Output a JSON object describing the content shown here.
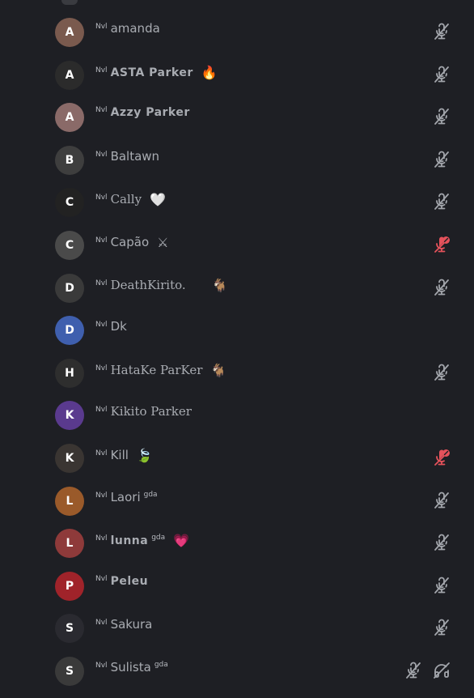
{
  "members": [
    {
      "lvl": "Nvl",
      "name": "amanda",
      "style": "normal",
      "avatar_color": "#7a5a4e",
      "initial": "A",
      "emoji": "",
      "status": [
        "mic-muted"
      ]
    },
    {
      "lvl": "Nvl",
      "name": "ASTA Parker",
      "style": "bold",
      "avatar_color": "#2b2b2b",
      "initial": "A",
      "emoji": "🔥",
      "status": [
        "mic-muted"
      ]
    },
    {
      "lvl": "Nvl",
      "name": "Azzy Parker",
      "style": "bold",
      "avatar_color": "#8a6a68",
      "initial": "A",
      "emoji": "",
      "status": [
        "mic-muted"
      ]
    },
    {
      "lvl": "Nvl",
      "name": "Baltawn",
      "style": "normal",
      "avatar_color": "#3e3e3e",
      "initial": "B",
      "emoji": "",
      "status": [
        "mic-muted"
      ]
    },
    {
      "lvl": "Nvl",
      "name": "Cally",
      "style": "serif",
      "avatar_color": "#222222",
      "initial": "C",
      "emoji": "🤍",
      "status": [
        "mic-muted"
      ]
    },
    {
      "lvl": "Nvl",
      "name": "Capão",
      "style": "normal",
      "avatar_color": "#4a4a4a",
      "initial": "C",
      "emoji": "⚔",
      "status": [
        "server-muted"
      ]
    },
    {
      "lvl": "Nvl",
      "name": "DeathKirito.",
      "style": "serif",
      "avatar_color": "#3a3a3a",
      "initial": "D",
      "emoji": "🐐",
      "emoji_far": true,
      "status": [
        "mic-muted"
      ]
    },
    {
      "lvl": "Nvl",
      "name": "Dk",
      "style": "normal",
      "avatar_color": "#3f5fae",
      "initial": "D",
      "emoji": "",
      "status": []
    },
    {
      "lvl": "Nvl",
      "name": "HataKe ParKer",
      "style": "serif",
      "avatar_color": "#2e2e2e",
      "initial": "H",
      "emoji": "🐐",
      "status": [
        "mic-muted"
      ]
    },
    {
      "lvl": "Nvl",
      "name": "Kikito Parker",
      "style": "serif",
      "avatar_color": "#5a3a8e",
      "initial": "K",
      "emoji": "",
      "status": []
    },
    {
      "lvl": "Nvl",
      "name": "Kill",
      "style": "normal",
      "avatar_color": "#3a3532",
      "initial": "K",
      "emoji": "🍃",
      "status": [
        "server-muted"
      ]
    },
    {
      "lvl": "Nvl",
      "name": "Laori",
      "style": "normal",
      "avatar_color": "#9a5a2a",
      "initial": "L",
      "tag": "gda",
      "emoji": "",
      "status": [
        "mic-muted"
      ]
    },
    {
      "lvl": "Nvl",
      "name": "lunna",
      "style": "bold",
      "avatar_color": "#8e3a3a",
      "initial": "L",
      "tag": "gda",
      "emoji": "💗",
      "status": [
        "mic-muted"
      ]
    },
    {
      "lvl": "Nvl",
      "name": "Peleu",
      "style": "bold",
      "avatar_color": "#a0232a",
      "initial": "P",
      "emoji": "",
      "status": [
        "mic-muted"
      ]
    },
    {
      "lvl": "Nvl",
      "name": "Sakura",
      "style": "normal",
      "avatar_color": "#2a2a30",
      "initial": "S",
      "emoji": "",
      "status": [
        "mic-muted"
      ]
    },
    {
      "lvl": "Nvl",
      "name": "Sulista",
      "style": "normal",
      "avatar_color": "#3a3a3a",
      "initial": "S",
      "tag": "gda",
      "emoji": "",
      "status": [
        "mic-muted",
        "headphones-deafened"
      ]
    }
  ],
  "colors": {
    "background": "#1e1f24",
    "icon_muted": "#a3a6ac",
    "icon_server_muted": "#e5525b"
  }
}
